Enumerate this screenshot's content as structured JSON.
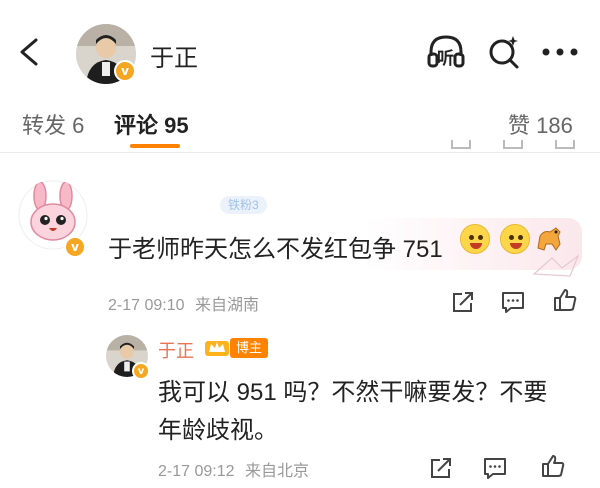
{
  "header": {
    "user_name": "于正",
    "verified_badge": "v",
    "icons": [
      "back-icon",
      "listen-icon",
      "search-icon",
      "more-icon"
    ],
    "listen_label": "听"
  },
  "tabs": [
    {
      "label": "转发 6",
      "active": false
    },
    {
      "label": "评论 95",
      "active": true
    },
    {
      "label": "赞 186",
      "active": false
    }
  ],
  "accent_color": "#ff8200",
  "comment": {
    "fan_badge": "铁粉3",
    "text": "于老师昨天怎么不发红包争 751",
    "emojis": [
      "money-face-emoji",
      "money-face-emoji",
      "horse-emoji"
    ],
    "time": "2-17 09:10",
    "source": "来自湖南"
  },
  "reply": {
    "user_name": "于正",
    "badge": "博主",
    "line1": "我可以 951 吗？不然干嘛要发？不要",
    "line2": "年龄歧视。",
    "time": "2-17 09:12",
    "source": "来自北京"
  }
}
